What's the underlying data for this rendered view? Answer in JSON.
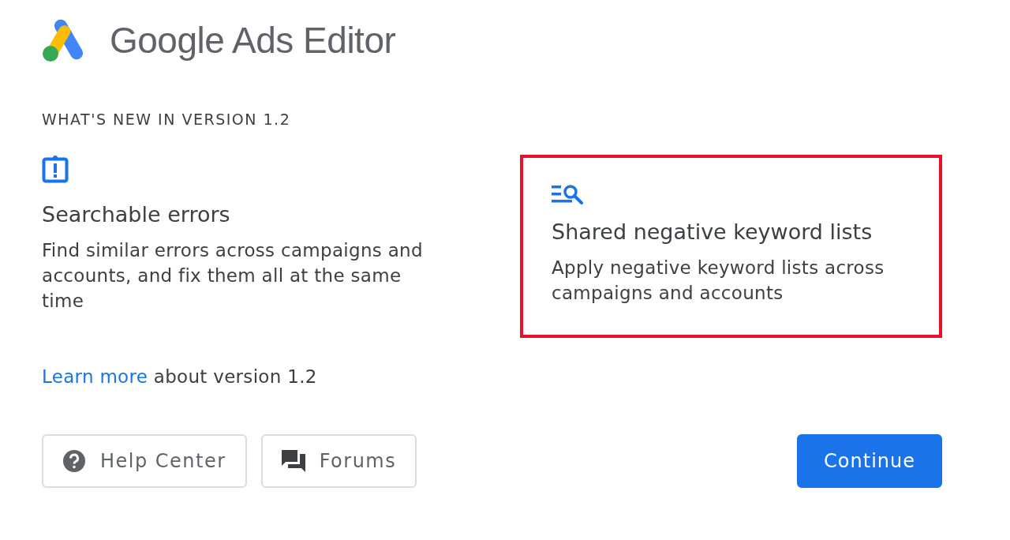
{
  "app": {
    "title": "Google Ads Editor"
  },
  "section_heading": "WHAT'S NEW IN VERSION 1.2",
  "features": [
    {
      "kind": "errors",
      "title": "Searchable errors",
      "description": "Find similar errors across campaigns and accounts, and fix them all at the same time",
      "highlighted": false
    },
    {
      "kind": "lists",
      "title": "Shared negative keyword lists",
      "description": "Apply negative keyword lists across campaigns and accounts",
      "highlighted": true
    }
  ],
  "learn_more": {
    "link": "Learn more",
    "text": "about version 1.2"
  },
  "buttons": [
    {
      "kind": "help",
      "label": "Help Center"
    },
    {
      "kind": "forums",
      "label": "Forums"
    },
    {
      "kind": "primary",
      "label": "Continue"
    }
  ]
}
